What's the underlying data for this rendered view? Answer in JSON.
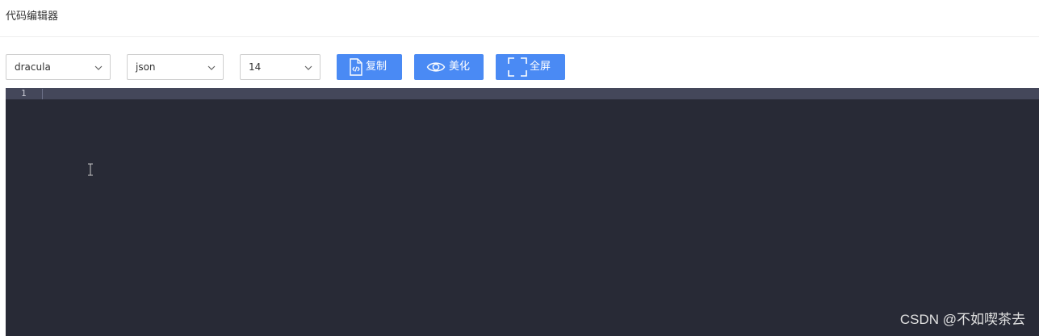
{
  "header": {
    "title": "代码编辑器"
  },
  "toolbar": {
    "theme_select": {
      "value": "dracula",
      "icon": "chevron-down-icon"
    },
    "language_select": {
      "value": "json",
      "icon": "chevron-down-icon"
    },
    "fontsize_select": {
      "value": "14",
      "icon": "chevron-down-icon"
    },
    "copy_button": {
      "label": "复制",
      "icon": "code-file-icon"
    },
    "beautify_button": {
      "label": "美化",
      "icon": "eye-icon"
    },
    "fullscreen_button": {
      "label": "全屏",
      "icon": "fullscreen-icon"
    },
    "button_color": "#4a8af4"
  },
  "editor": {
    "theme_background": "#282a36",
    "active_line_color": "#44475a",
    "line_numbers": [
      "1"
    ],
    "content": ""
  },
  "watermark": {
    "text": "CSDN @不如喫茶去"
  }
}
